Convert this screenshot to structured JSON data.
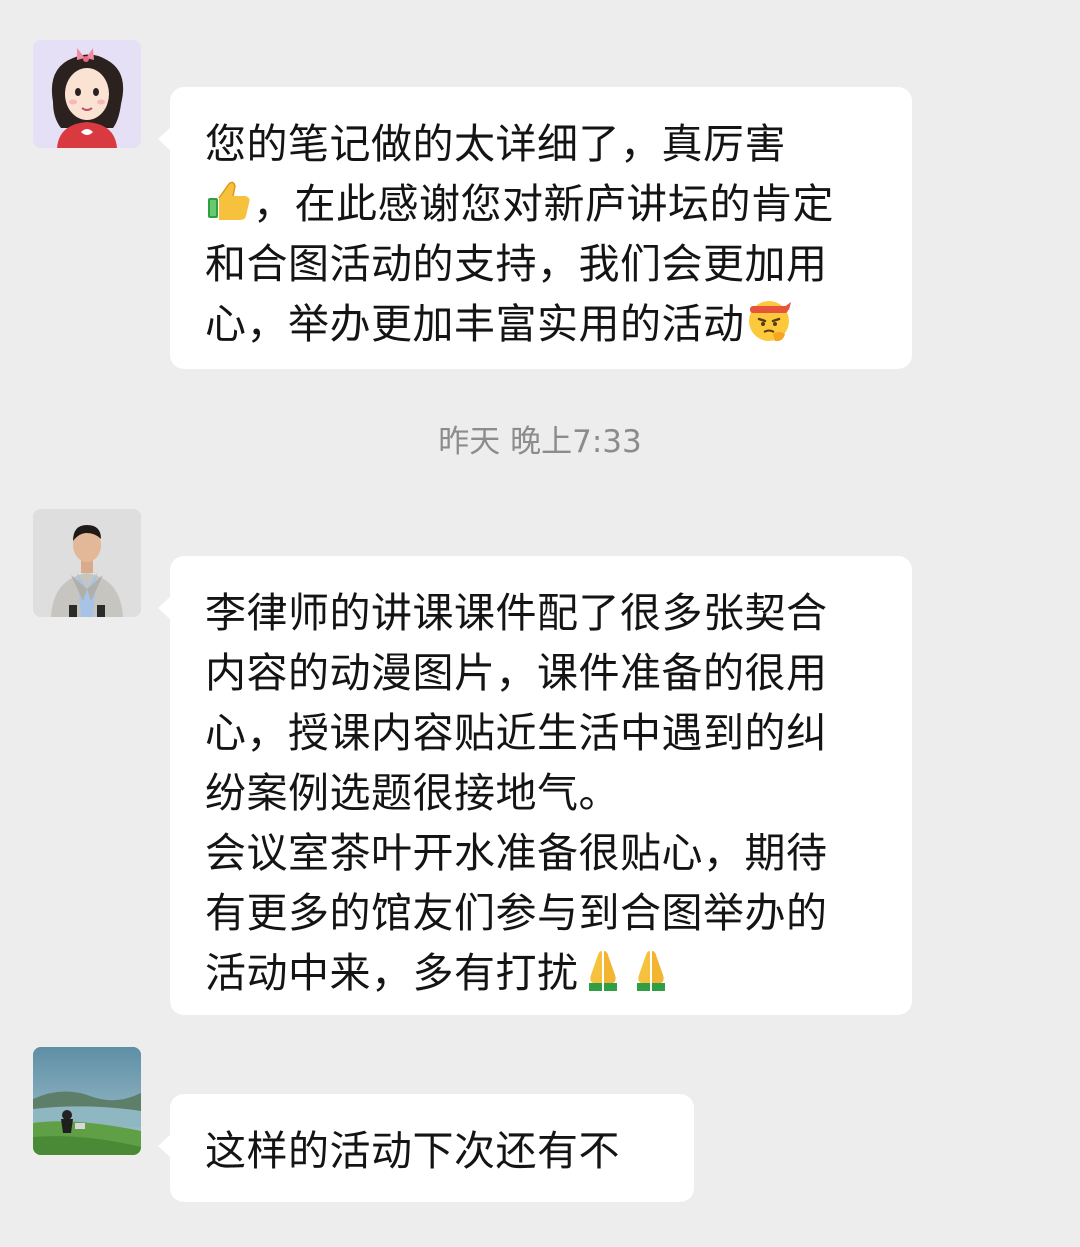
{
  "messages": [
    {
      "lines": [
        "您的笔记做的太详细了，真厉害",
        "，在此感谢您对新庐讲坛的肯定",
        "和合图活动的支持，我们会更加用",
        "心，举办更加丰富实用的活动"
      ],
      "emojis": [
        "thumbs-up",
        "determined-face"
      ]
    },
    {
      "lines": [
        "李律师的讲课课件配了很多张契合",
        "内容的动漫图片，课件准备的很用",
        "心，授课内容贴近生活中遇到的纠",
        "纷案例选题很接地气。",
        "会议室茶叶开水准备很贴心，期待",
        "有更多的馆友们参与到合图举办的",
        "活动中来，多有打扰"
      ],
      "emojis": [
        "folded-hands",
        "folded-hands"
      ]
    },
    {
      "lines": [
        "这样的活动下次还有不"
      ]
    }
  ],
  "timestamp": "昨天 晚上7:33",
  "colors": {
    "background": "#ededed",
    "bubble": "#ffffff",
    "text": "#141414",
    "timestamp": "#8c8c8c"
  }
}
